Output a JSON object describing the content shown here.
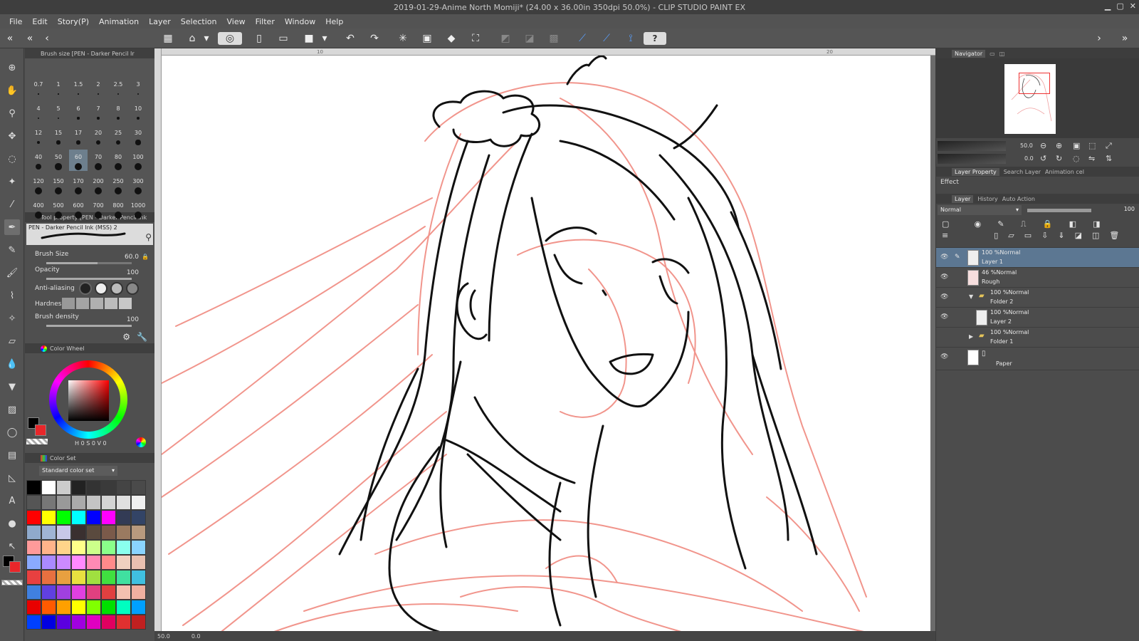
{
  "window": {
    "title": "2019-01-29-Anime North Momiji* (24.00 x 36.00in 350dpi 50.0%)  - CLIP STUDIO PAINT EX"
  },
  "menu": [
    "File",
    "Edit",
    "Story(P)",
    "Animation",
    "Layer",
    "Selection",
    "View",
    "Filter",
    "Window",
    "Help"
  ],
  "brush_size_panel": {
    "tab_title": "Brush size [PEN - Darker Pencil Ir",
    "sizes": [
      "0.7",
      "1",
      "1.5",
      "2",
      "2.5",
      "3",
      "4",
      "5",
      "6",
      "7",
      "8",
      "10",
      "12",
      "15",
      "17",
      "20",
      "25",
      "30",
      "40",
      "50",
      "60",
      "70",
      "80",
      "100",
      "120",
      "150",
      "170",
      "200",
      "250",
      "300",
      "400",
      "500",
      "600",
      "700",
      "800",
      "1000"
    ],
    "selected": "60"
  },
  "tool_property": {
    "tab_title": "Tool property [PEN - Darker Pencil Ink",
    "preset_name": "PEN - Darker Pencil Ink (MSS) 2",
    "brush_size_label": "Brush Size",
    "brush_size_value": "60.0",
    "brush_size_fraction": 0.6,
    "opacity_label": "Opacity",
    "opacity_value": "100",
    "anti_aliasing_label": "Anti-aliasing",
    "hardness_label": "Hardness",
    "brush_density_label": "Brush density",
    "brush_density_value": "100"
  },
  "color_wheel": {
    "tab_title": "Color Wheel",
    "h_value": "0",
    "s_value": "0",
    "v_value": "0",
    "main_color": "#000000",
    "sub_color": "#e8262a"
  },
  "color_set": {
    "tab_title": "Color Set",
    "selected_set": "Standard color set",
    "swatches": [
      "#000000",
      "#ffffff",
      "#cccccc",
      "#222222",
      "#333333",
      "#3a3a3a",
      "#444444",
      "#4a4a4a",
      "#555555",
      "#777777",
      "#999999",
      "#aaaaaa",
      "#c4c4c4",
      "#d4d4d4",
      "#e0e0e0",
      "#f0f0f0",
      "#ff0000",
      "#ffff00",
      "#00ff00",
      "#00ffff",
      "#0000ff",
      "#ff00ff",
      "#333b55",
      "#334466",
      "#8faacc",
      "#a0b4d4",
      "#c8c8e8",
      "#3a3030",
      "#5a4a3e",
      "#7a5a4a",
      "#9a7a60",
      "#b89a7e",
      "#ff9a9a",
      "#ffb48a",
      "#ffd48a",
      "#ffff8a",
      "#ccff8a",
      "#8aff8a",
      "#8affee",
      "#8ad4ff",
      "#8aaaff",
      "#aa8aff",
      "#cc8aff",
      "#ff8aff",
      "#ff8ab4",
      "#ff8a8a",
      "#f0d0c0",
      "#e8c0b0",
      "#e84040",
      "#e87040",
      "#e8a040",
      "#e8e040",
      "#a0e040",
      "#40e040",
      "#40e0a0",
      "#40c0e0",
      "#4080e0",
      "#6040e0",
      "#a040e0",
      "#e040e0",
      "#e04080",
      "#e04040",
      "#f4c0b0",
      "#f0b0a0",
      "#e80000",
      "#ff5a00",
      "#ffa000",
      "#ffff00",
      "#80ff00",
      "#00e000",
      "#00ffc0",
      "#00a0ff",
      "#0040ff",
      "#0000e0",
      "#5a00e0",
      "#a000e0",
      "#e000c0",
      "#e00060",
      "#e03030",
      "#c02020"
    ]
  },
  "toolbar": {
    "help_label": "?"
  },
  "canvas": {
    "ruler_marks": [
      "10",
      "20"
    ],
    "zoom": "50.0",
    "angle": "0.0"
  },
  "navigator": {
    "tab_title": "Navigator",
    "zoom_value": "50.0",
    "rotate_value": "0.0"
  },
  "layer_property": {
    "tabs": [
      "Layer Property",
      "Search Layer",
      "Animation cel"
    ],
    "effect_label": "Effect"
  },
  "layer_panel": {
    "tabs": [
      "Layer",
      "History",
      "Auto Action"
    ],
    "blend_mode": "Normal",
    "opacity": "100",
    "layers": [
      {
        "mode": "100 %Normal",
        "name": "Layer 1",
        "selected": true,
        "visible": true,
        "type": "raster"
      },
      {
        "mode": "46 %Normal",
        "name": "Rough",
        "selected": false,
        "visible": true,
        "type": "raster"
      },
      {
        "mode": "100 %Normal",
        "name": "Folder 2",
        "selected": false,
        "visible": true,
        "type": "folder-open"
      },
      {
        "mode": "100 %Normal",
        "name": "Layer 2",
        "selected": false,
        "visible": true,
        "type": "raster-child"
      },
      {
        "mode": "100 %Normal",
        "name": "Folder 1",
        "selected": false,
        "visible": false,
        "type": "folder-closed"
      },
      {
        "mode": "",
        "name": "Paper",
        "selected": false,
        "visible": true,
        "type": "paper"
      }
    ]
  },
  "status": {
    "zoom": "50.0",
    "rotation": "0.0"
  },
  "colors": {
    "sketch_red": "#f08a80",
    "ink": "#111111",
    "selection": "#5c7792"
  }
}
